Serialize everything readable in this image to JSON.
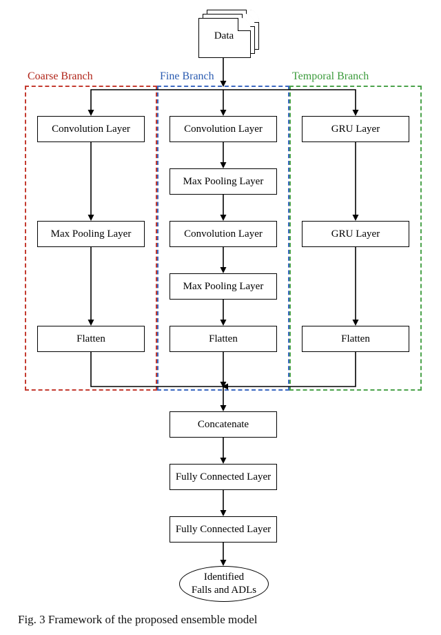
{
  "diagram": {
    "data_label": "Data",
    "branches": {
      "coarse": {
        "title": "Coarse Branch",
        "layers": [
          "Convolution Layer",
          "Max Pooling Layer",
          "Flatten"
        ]
      },
      "fine": {
        "title": "Fine Branch",
        "layers": [
          "Convolution Layer",
          "Max Pooling Layer",
          "Convolution Layer",
          "Max Pooling Layer",
          "Flatten"
        ]
      },
      "temporal": {
        "title": "Temporal Branch",
        "layers": [
          "GRU Layer",
          "GRU Layer",
          "Flatten"
        ]
      }
    },
    "post": [
      "Concatenate",
      "Fully Connected Layer",
      "Fully Connected Layer"
    ],
    "output": "Identified\nFalls and ADLs",
    "caption": "Fig. 3 Framework of the proposed ensemble model"
  }
}
